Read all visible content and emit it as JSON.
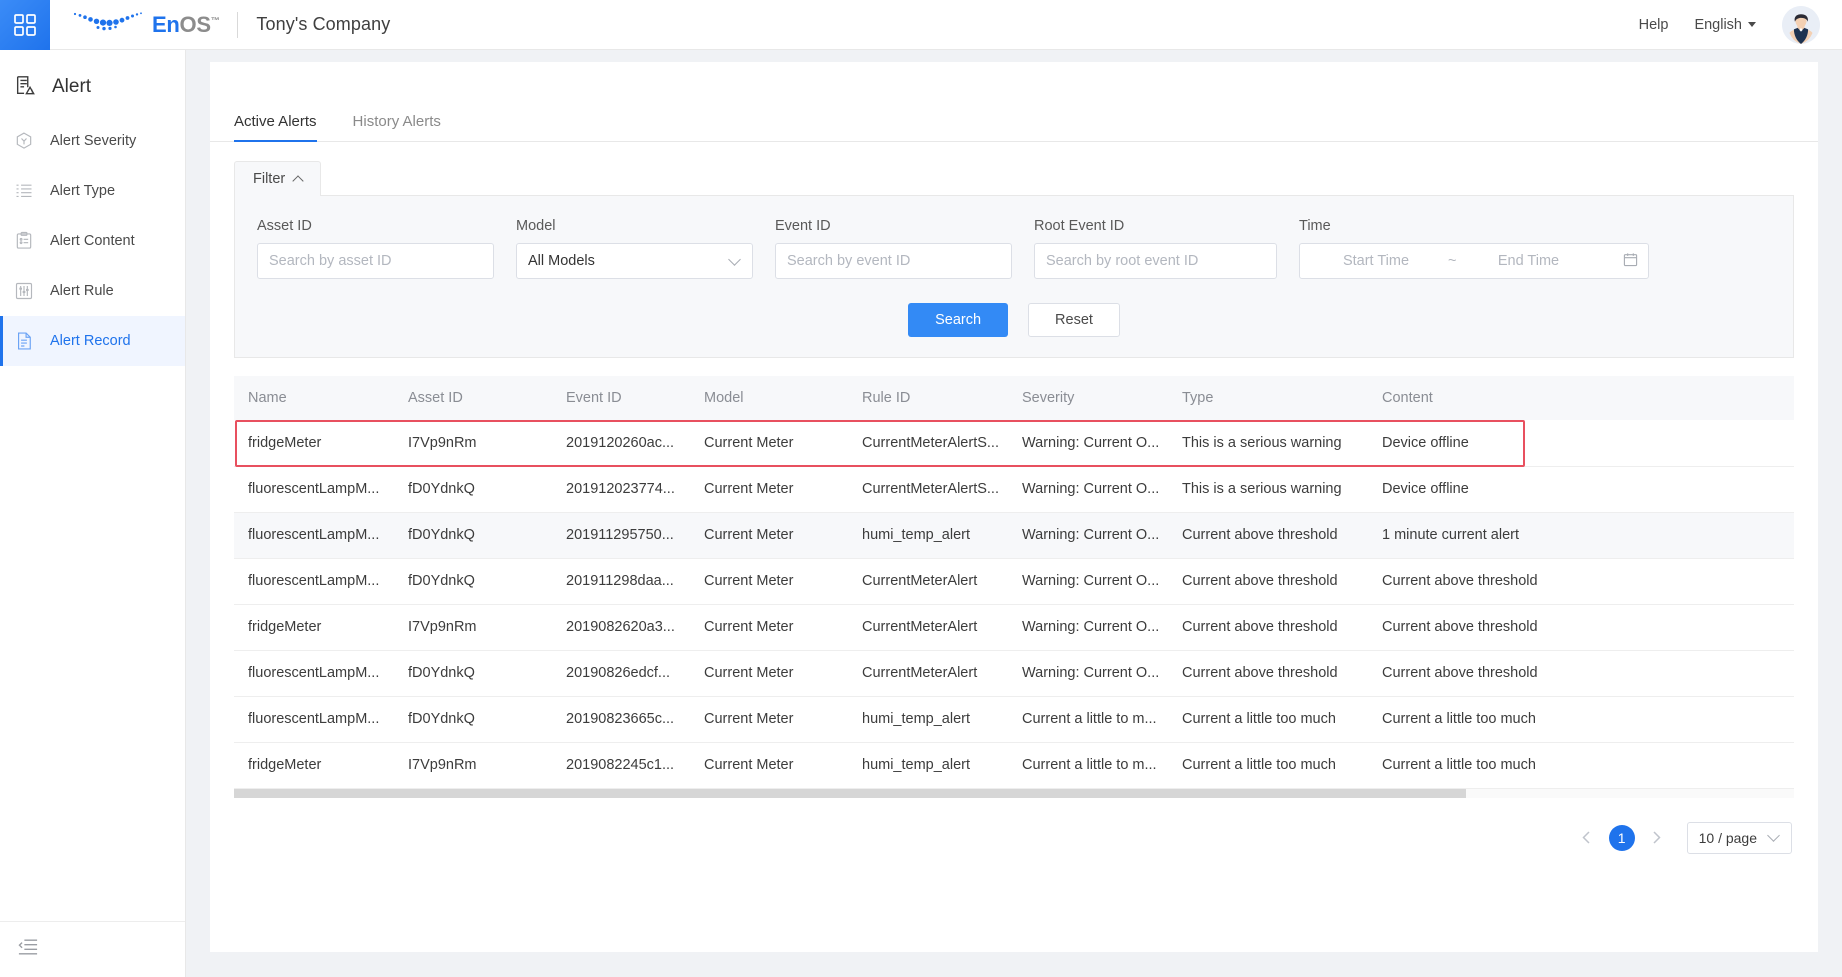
{
  "header": {
    "launcher_icon": "grid-apps-icon",
    "brand_en": "En",
    "brand_os": "OS",
    "brand_tm": "™",
    "company": "Tony's Company",
    "help_label": "Help",
    "language_label": "English",
    "avatar_icon": "user-avatar"
  },
  "sidebar": {
    "title": "Alert",
    "title_icon": "alert-doc-icon",
    "items": [
      {
        "label": "Alert Severity",
        "icon": "severity-hex-icon",
        "active": false
      },
      {
        "label": "Alert Type",
        "icon": "list-type-icon",
        "active": false
      },
      {
        "label": "Alert Content",
        "icon": "clipboard-icon",
        "active": false
      },
      {
        "label": "Alert Rule",
        "icon": "sliders-icon",
        "active": false
      },
      {
        "label": "Alert Record",
        "icon": "document-lines-icon",
        "active": true
      }
    ],
    "collapse_icon": "menu-collapse-icon"
  },
  "tabs": [
    {
      "label": "Active Alerts",
      "active": true
    },
    {
      "label": "History Alerts",
      "active": false
    }
  ],
  "filter": {
    "toggle_label": "Filter",
    "toggle_icon": "chevron-up-icon",
    "fields": {
      "asset_id": {
        "label": "Asset ID",
        "placeholder": "Search by asset ID",
        "value": ""
      },
      "model": {
        "label": "Model",
        "value": "All Models",
        "chevron_icon": "chevron-down-icon"
      },
      "event_id": {
        "label": "Event ID",
        "placeholder": "Search by event ID",
        "value": ""
      },
      "root_event_id": {
        "label": "Root Event ID",
        "placeholder": "Search by root event ID",
        "value": ""
      },
      "time": {
        "label": "Time",
        "start_placeholder": "Start Time",
        "separator": "~",
        "end_placeholder": "End Time",
        "calendar_icon": "calendar-icon"
      }
    },
    "search_label": "Search",
    "reset_label": "Reset"
  },
  "table": {
    "columns": [
      "Name",
      "Asset ID",
      "Event ID",
      "Model",
      "Rule ID",
      "Severity",
      "Type",
      "Content"
    ],
    "rows": [
      {
        "name": "fridgeMeter",
        "asset_id": "I7Vp9nRm",
        "event_id": "2019120260ac...",
        "model": "Current Meter",
        "rule_id": "CurrentMeterAlertS...",
        "severity": "Warning: Current O...",
        "type": "This is a serious warning",
        "content": "Device offline",
        "highlighted": true,
        "striped": false
      },
      {
        "name": "fluorescentLampM...",
        "asset_id": "fD0YdnkQ",
        "event_id": "201912023774...",
        "model": "Current Meter",
        "rule_id": "CurrentMeterAlertS...",
        "severity": "Warning: Current O...",
        "type": "This is a serious warning",
        "content": "Device offline",
        "highlighted": false,
        "striped": false
      },
      {
        "name": "fluorescentLampM...",
        "asset_id": "fD0YdnkQ",
        "event_id": "201911295750...",
        "model": "Current Meter",
        "rule_id": "humi_temp_alert",
        "severity": "Warning: Current O...",
        "type": "Current above threshold",
        "content": "1 minute current alert",
        "highlighted": false,
        "striped": true
      },
      {
        "name": "fluorescentLampM...",
        "asset_id": "fD0YdnkQ",
        "event_id": "201911298daa...",
        "model": "Current Meter",
        "rule_id": "CurrentMeterAlert",
        "severity": "Warning: Current O...",
        "type": "Current above threshold",
        "content": "Current above threshold",
        "highlighted": false,
        "striped": false
      },
      {
        "name": "fridgeMeter",
        "asset_id": "I7Vp9nRm",
        "event_id": "2019082620a3...",
        "model": "Current Meter",
        "rule_id": "CurrentMeterAlert",
        "severity": "Warning: Current O...",
        "type": "Current above threshold",
        "content": "Current above threshold",
        "highlighted": false,
        "striped": false
      },
      {
        "name": "fluorescentLampM...",
        "asset_id": "fD0YdnkQ",
        "event_id": "20190826edcf...",
        "model": "Current Meter",
        "rule_id": "CurrentMeterAlert",
        "severity": "Warning: Current O...",
        "type": "Current above threshold",
        "content": "Current above threshold",
        "highlighted": false,
        "striped": false
      },
      {
        "name": "fluorescentLampM...",
        "asset_id": "fD0YdnkQ",
        "event_id": "20190823665c...",
        "model": "Current Meter",
        "rule_id": "humi_temp_alert",
        "severity": "Current a little to m...",
        "type": "Current a little too much",
        "content": "Current a little too much",
        "highlighted": false,
        "striped": false
      },
      {
        "name": "fridgeMeter",
        "asset_id": "I7Vp9nRm",
        "event_id": "2019082245c1...",
        "model": "Current Meter",
        "rule_id": "humi_temp_alert",
        "severity": "Current a little to m...",
        "type": "Current a little too much",
        "content": "Current a little too much",
        "highlighted": false,
        "striped": false
      }
    ]
  },
  "pagination": {
    "prev_icon": "chevron-left-icon",
    "next_icon": "chevron-right-icon",
    "current_page": "1",
    "page_size_label": "10 / page",
    "page_size_icon": "chevron-down-icon"
  },
  "colors": {
    "accent": "#1f73ec",
    "primary_button": "#338af5",
    "highlight_border": "#e8505f",
    "panel_bg": "#f7f8fa",
    "page_bg": "#f0f2f5"
  }
}
